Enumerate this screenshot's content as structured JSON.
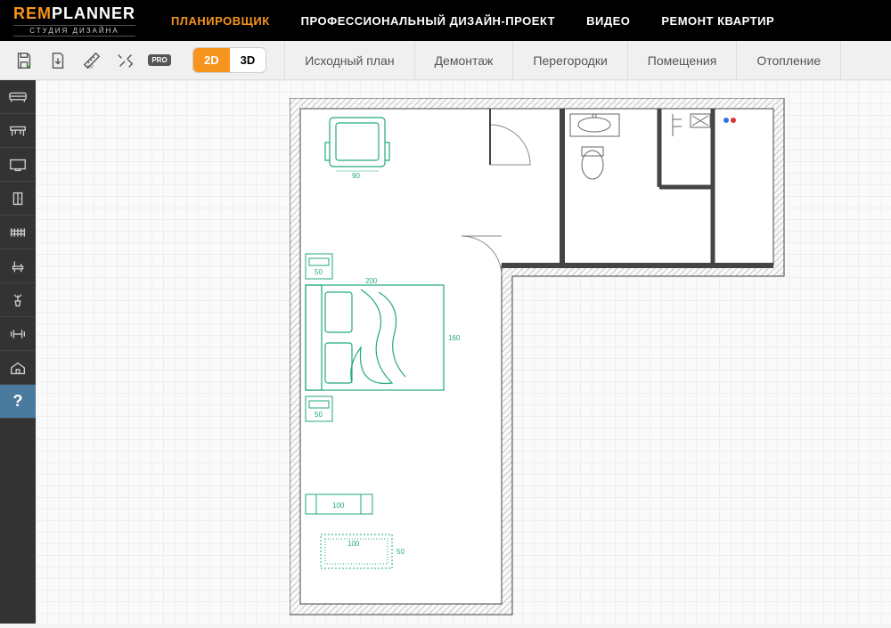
{
  "logo": {
    "brand_prefix": "REM",
    "brand_suffix": "PLANNER",
    "tagline": "СТУДИЯ ДИЗАЙНА"
  },
  "nav": {
    "planner": "ПЛАНИРОВЩИК",
    "design": "ПРОФЕССИОНАЛЬНЫЙ ДИЗАЙН-ПРОЕКТ",
    "video": "ВИДЕО",
    "renovation": "РЕМОНТ КВАРТИР"
  },
  "toolbar": {
    "pro": "PRO",
    "view_2d": "2D",
    "view_3d": "3D"
  },
  "tabs": {
    "source": "Исходный план",
    "demolition": "Демонтаж",
    "partitions": "Перегородки",
    "rooms": "Помещения",
    "heating": "Отопление"
  },
  "sidebar": {
    "help": "?"
  },
  "dimensions": {
    "chair": "90",
    "ns1": "50",
    "bed_w": "200",
    "bed_h": "160",
    "ns2": "50",
    "rug_w": "100",
    "shelf_w": "100",
    "shelf_h": "50"
  }
}
